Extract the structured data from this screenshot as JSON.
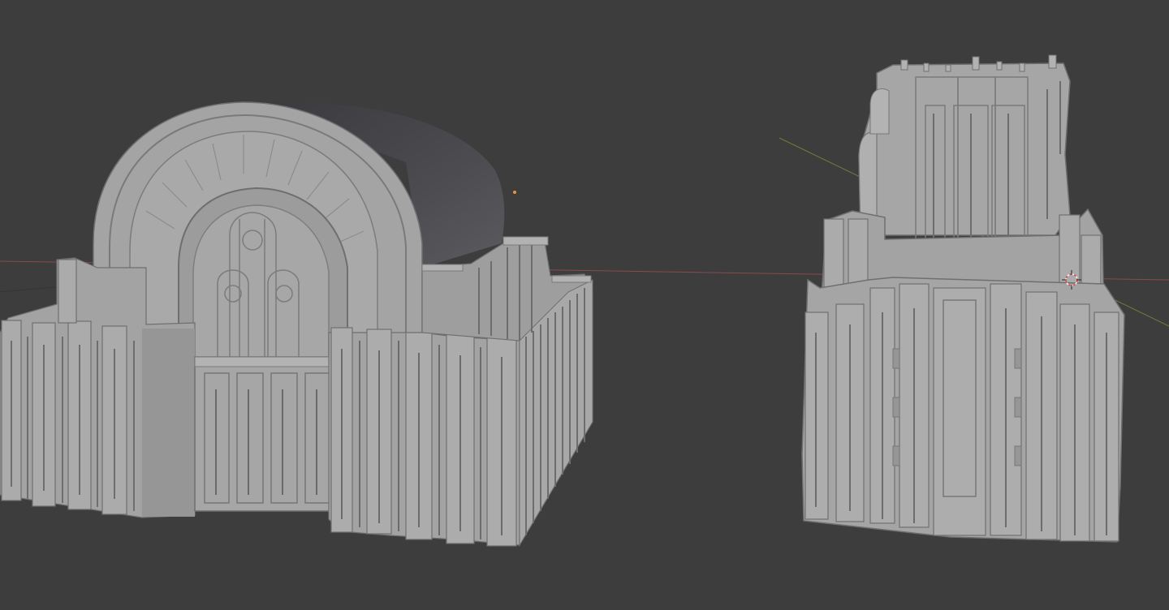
{
  "viewport": {
    "background_color": "#3d3d3d",
    "axis_x_color": "#8a4a4f",
    "axis_y_color": "#6b7f3a",
    "model_color": "#a3a3a3",
    "model_shadow_color": "#8a8a8a",
    "model_light_color": "#b4b4b4",
    "model_outline_color": "#6f6f6f",
    "roof_dark_color": "#4a494d",
    "origin_dot_color": "#e59a3a",
    "cursor_color_a": "#d94c4c",
    "cursor_color_b": "#f0f0f0",
    "objects": [
      "arched-hall-model",
      "stepped-tower-model"
    ],
    "icons": [
      "3d-cursor-icon",
      "object-origin-icon"
    ]
  }
}
